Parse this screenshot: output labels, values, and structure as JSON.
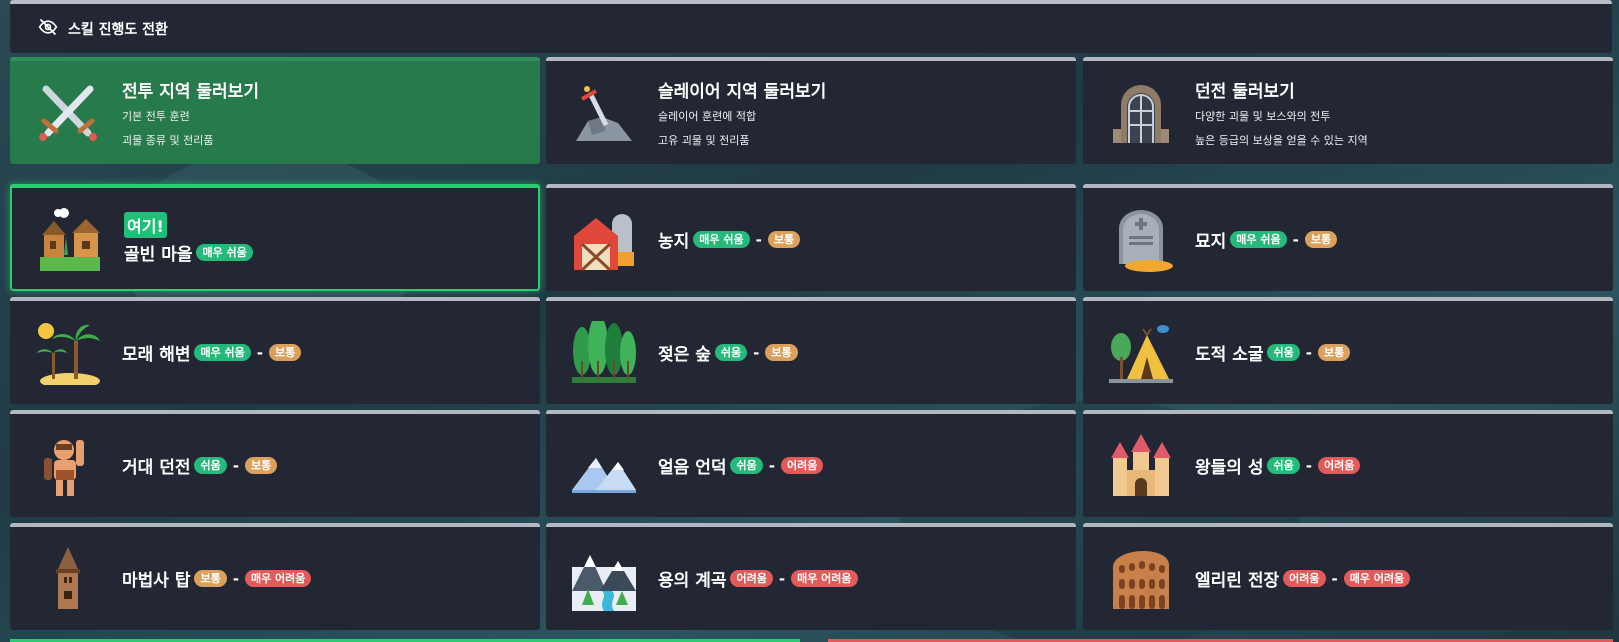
{
  "toggle": {
    "label": "스킬 진행도 전환",
    "icon": "eye-slash-icon"
  },
  "top_cards": [
    {
      "title": "전투 지역 둘러보기",
      "line1": "기본 전투 훈련",
      "line2": "괴물 종류 및 전리품",
      "icon": "crossed-swords-icon"
    },
    {
      "title": "슬레이어 지역 둘러보기",
      "line1": "슬레이어 훈련에 적합",
      "line2": "고유 괴물 및 전리품",
      "icon": "sword-in-stone-icon"
    },
    {
      "title": "던전 둘러보기",
      "line1": "다양한 괴물 및 보스와의 전투",
      "line2": "높은 등급의 보상을 얻을 수 있는 지역",
      "icon": "dungeon-door-icon"
    }
  ],
  "here_label": "여기!",
  "separator": "-",
  "areas": [
    {
      "name": "골빈 마을",
      "d1": "매우 쉬움",
      "d2": "",
      "icon": "village-icon"
    },
    {
      "name": "농지",
      "d1": "매우 쉬움",
      "d2": "보통",
      "icon": "barn-icon"
    },
    {
      "name": "묘지",
      "d1": "매우 쉬움",
      "d2": "보통",
      "icon": "gravestone-icon"
    },
    {
      "name": "모래 해변",
      "d1": "매우 쉬움",
      "d2": "보통",
      "icon": "palm-beach-icon"
    },
    {
      "name": "젖은 숲",
      "d1": "쉬움",
      "d2": "보통",
      "icon": "forest-icon"
    },
    {
      "name": "도적 소굴",
      "d1": "쉬움",
      "d2": "보통",
      "icon": "tent-icon"
    },
    {
      "name": "거대 던전",
      "d1": "쉬움",
      "d2": "보통",
      "icon": "giant-icon"
    },
    {
      "name": "얼음 언덕",
      "d1": "쉬움",
      "d2": "어려움",
      "icon": "ice-hills-icon"
    },
    {
      "name": "왕들의 성",
      "d1": "쉬움",
      "d2": "어려움",
      "icon": "castle-icon"
    },
    {
      "name": "마법사 탑",
      "d1": "보통",
      "d2": "매우 어려움",
      "icon": "wizard-tower-icon"
    },
    {
      "name": "용의 계곡",
      "d1": "어려움",
      "d2": "매우 어려움",
      "icon": "dragon-valley-icon"
    },
    {
      "name": "엘리린 전장",
      "d1": "어려움",
      "d2": "매우 어려움",
      "icon": "colosseum-icon"
    }
  ],
  "colors": {
    "card_bg": "#222733",
    "highlight_green": "#277a4b",
    "badge_green": "#25b97a",
    "badge_orange": "#dba05b",
    "badge_red": "#e45a5a"
  }
}
